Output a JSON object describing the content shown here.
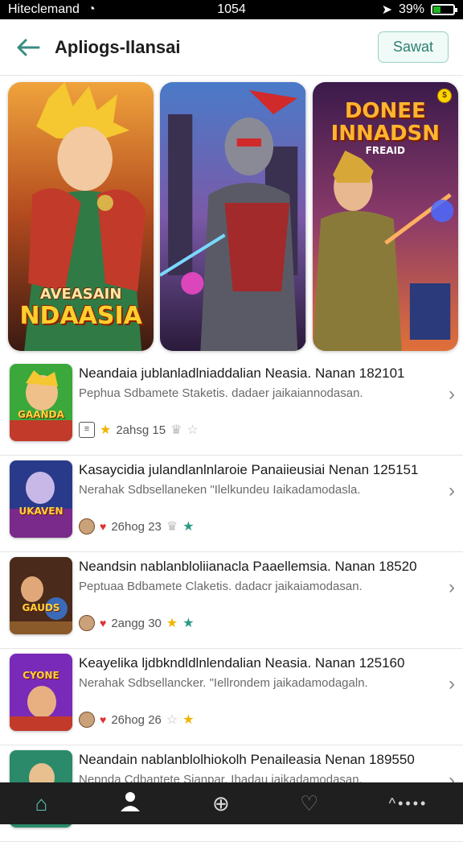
{
  "status": {
    "carrier": "Hiteclemand",
    "time": "1054",
    "battery_text": "39%",
    "battery_level": 0.39
  },
  "header": {
    "title": "Apliogs-Ilansai",
    "action_label": "Sawat"
  },
  "banners": [
    {
      "line1": "AVEASAIN",
      "line2": "NDAASIA"
    },
    {
      "line1": "",
      "line2": ""
    },
    {
      "line1": "DONEE INNADSN",
      "line2": "FREAID",
      "badge": "$"
    }
  ],
  "apps": [
    {
      "thumb_text": "GAANDA",
      "name": "Neandaia jublanladlniaddalian Neasia. Nanan 182101",
      "desc": "Pephua Sdbamete Staketis. dadaer jaikaiannodasan.",
      "meta": "2ahsg 15"
    },
    {
      "thumb_text": "UKAVEN",
      "name": "Kasaycidia julandlanlnlaroie Panaiieusiai Nenan 125151",
      "desc": "Nerahak Sdbsellaneken \"Ilelkundeu Iaikadamodasla.",
      "meta": "26hog 23"
    },
    {
      "thumb_text": "GAUDS",
      "name": "Neandsin nablanbloliianacla Paaellemsia. Nanan 18520",
      "desc": "Peptuaa Bdbamete Claketis. dadacr jaikaiamodasan.",
      "meta": "2angg 30"
    },
    {
      "thumb_text": "CYONE",
      "name": "Keayelika ljdbkndldlnlendalian Neasia. Nanan 125160",
      "desc": "Nerahak Sdbsellancker. \"Iellrondem jaikadamodagaln.",
      "meta": "26hog 26"
    },
    {
      "thumb_text": "",
      "name": "Neandain nablanblolhiokolh Penaileasia Nenan 189550",
      "desc": "Nepnda Cdbantete Sianpar. Ihadau jaikadamodasan.",
      "meta": ""
    }
  ],
  "icons": {
    "back": "arrow-left-icon",
    "nav": [
      "home-icon",
      "profile-icon",
      "add-circle-icon",
      "heart-icon",
      "more-icon"
    ]
  }
}
